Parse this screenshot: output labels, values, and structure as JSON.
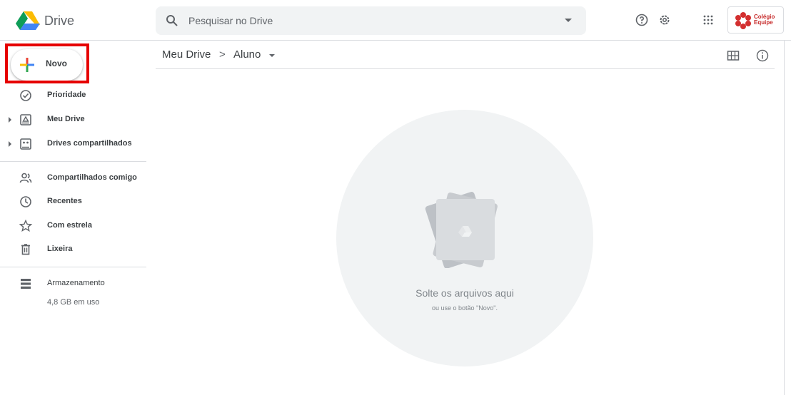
{
  "header": {
    "app_title": "Drive",
    "search_placeholder": "Pesquisar no Drive",
    "brand_line1": "Colégio",
    "brand_line2": "Equipe"
  },
  "sidebar": {
    "new_label": "Novo",
    "items": [
      {
        "label": "Prioridade",
        "icon": "priority-check-icon"
      },
      {
        "label": "Meu Drive",
        "icon": "my-drive-icon"
      },
      {
        "label": "Drives compartilhados",
        "icon": "shared-drives-icon"
      },
      {
        "label": "Compartilhados comigo",
        "icon": "shared-with-me-icon"
      },
      {
        "label": "Recentes",
        "icon": "clock-icon"
      },
      {
        "label": "Com estrela",
        "icon": "star-icon"
      },
      {
        "label": "Lixeira",
        "icon": "trash-icon"
      },
      {
        "label": "Armazenamento",
        "icon": "storage-icon"
      }
    ],
    "storage_used": "4,8 GB em uso"
  },
  "main": {
    "breadcrumb": [
      "Meu Drive",
      ">",
      "Aluno"
    ],
    "drop_title": "Solte os arquivos aqui",
    "drop_subtitle": "ou use o botão \"Novo\"."
  },
  "colors": {
    "accent_red": "#e60000",
    "brand_red": "#c62828",
    "text": "#3c4043",
    "muted": "#5f6368"
  }
}
